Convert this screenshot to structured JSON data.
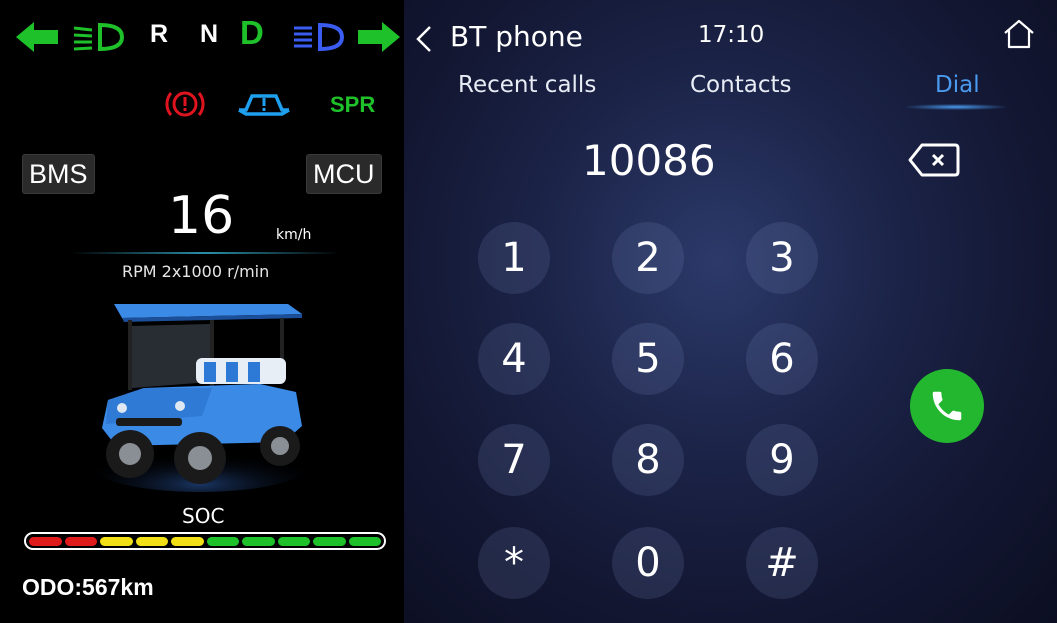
{
  "status_bar": {
    "gears": [
      "R",
      "N",
      "D"
    ],
    "active_gear": "D",
    "warning_labels": {
      "spr": "SPR"
    },
    "colors": {
      "green": "#1fc12b",
      "blue": "#3a5cf0",
      "red": "#e0141e",
      "cyan": "#1f9ff0"
    }
  },
  "left_panel": {
    "bms_label": "BMS",
    "mcu_label": "MCU",
    "speed": "16",
    "speed_unit": "km/h",
    "rpm_label": "RPM 2x1000 r/min",
    "soc_label": "SOC",
    "soc_segments": [
      "red",
      "red",
      "yellow",
      "yellow",
      "yellow",
      "green",
      "green",
      "green",
      "green",
      "green"
    ],
    "odo": "ODO:567km"
  },
  "header": {
    "title": "BT phone",
    "time": "17:10"
  },
  "tabs": [
    {
      "label": "Recent calls",
      "active": false
    },
    {
      "label": "Contacts",
      "active": false
    },
    {
      "label": "Dial",
      "active": true
    }
  ],
  "dial": {
    "number": "10086",
    "keys": [
      "1",
      "2",
      "3",
      "4",
      "5",
      "6",
      "7",
      "8",
      "9",
      "*",
      "0",
      "#"
    ]
  }
}
